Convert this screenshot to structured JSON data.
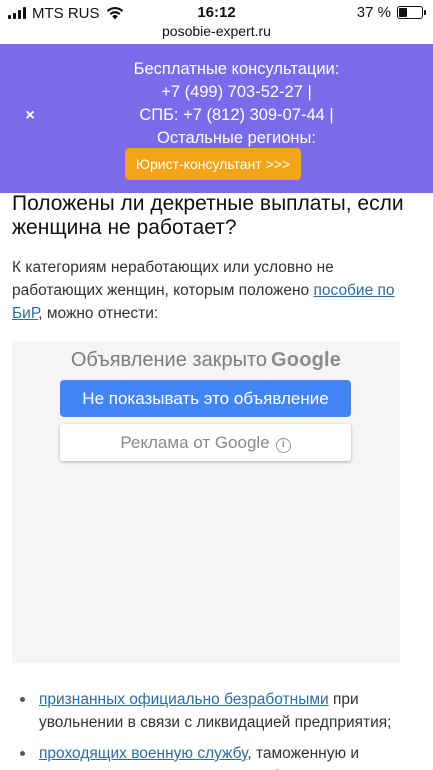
{
  "status_bar": {
    "carrier": "MTS RUS",
    "time": "16:12",
    "url": "posobie-expert.ru",
    "battery": "37 %",
    "battery_level": 0.37
  },
  "banner": {
    "close_symbol": "×",
    "line1": "Бесплатные консультации:",
    "line2": "+7 (499) 703-52-27 |",
    "line3": "СПБ: +7 (812) 309-07-44 |",
    "line4": "Остальные регионы:",
    "button_label": "Юрист-консультант >>>",
    "bg_color": "#7b6bea",
    "button_color": "#f3a419"
  },
  "article": {
    "title": "Положены ли декретные выплаты, если женщина не работает?",
    "intro_before": "К категориям неработающих или условно не работающих женщин, которым положено ",
    "intro_link": "пособие по БиР",
    "intro_after": ", можно отнести:"
  },
  "ad": {
    "closed_text": "Объявление закрыто",
    "brand": "Google",
    "hide_button": "Не показывать это объявление",
    "by_label": "Реклама от Google",
    "info_symbol": "i"
  },
  "list": [
    {
      "link": "признанных официально безработными",
      "text": " при увольнении в связи с ликвидацией предприятия;"
    },
    {
      "link": "проходящих военную службу",
      "text": ", таможенную и некоторые другие виды госслужбы по контракту;"
    }
  ]
}
